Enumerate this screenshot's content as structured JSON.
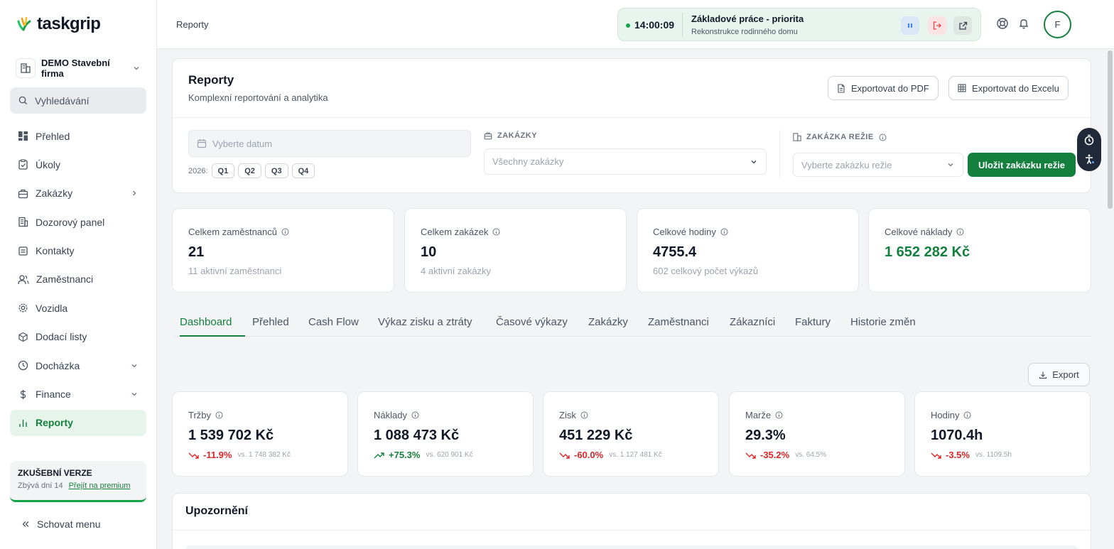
{
  "app": {
    "brand": "taskgrip"
  },
  "sidebar": {
    "company": "DEMO Stavební firma",
    "search_label": "Vyhledávání",
    "items": [
      {
        "label": "Přehled",
        "icon": "dashboard-icon"
      },
      {
        "label": "Úkoly",
        "icon": "clipboard-check-icon"
      },
      {
        "label": "Zakázky",
        "icon": "briefcase-icon"
      },
      {
        "label": "Dozorový panel",
        "icon": "building-panel-icon"
      },
      {
        "label": "Kontakty",
        "icon": "contacts-icon"
      },
      {
        "label": "Zaměstnanci",
        "icon": "users-icon"
      },
      {
        "label": "Vozidla",
        "icon": "gear-icon"
      },
      {
        "label": "Dodací listy",
        "icon": "package-icon"
      },
      {
        "label": "Docházka",
        "icon": "clock-icon"
      },
      {
        "label": "Finance",
        "icon": "dollar-icon"
      },
      {
        "label": "Reporty",
        "icon": "bar-chart-icon",
        "active": true
      }
    ],
    "trial": {
      "title": "ZKUŠEBNÍ VERZE",
      "days_left": "Zbývá dní 14",
      "upgrade_link": "Přejít na premium"
    },
    "hide_menu": "Schovat menu"
  },
  "topbar": {
    "title": "Reporty",
    "timer": {
      "time": "14:00:09",
      "task": "Základové práce - priorita",
      "project": "Rekonstrukce rodinného domu"
    },
    "avatar_initial": "F"
  },
  "reports": {
    "title": "Reporty",
    "subtitle": "Komplexní reportování a analytika",
    "export_pdf": "Exportovat do PDF",
    "export_excel": "Exportovat do Excelu",
    "date_placeholder": "Vyberte datum",
    "year_label": "2026:",
    "quarters": [
      "Q1",
      "Q2",
      "Q3",
      "Q4"
    ],
    "jobs_label": "ZAKÁZKY",
    "jobs_value": "Všechny zakázky",
    "overhead_label": "ZAKÁZKA REŽIE",
    "overhead_placeholder": "Vyberte zakázku režie",
    "save_overhead": "Uložit zakázku režie"
  },
  "summary": [
    {
      "label": "Celkem zaměstnanců",
      "value": "21",
      "sub": "11 aktivní zaměstnanci"
    },
    {
      "label": "Celkem zakázek",
      "value": "10",
      "sub": "4 aktivní zakázky"
    },
    {
      "label": "Celkové hodiny",
      "value": "4755.4",
      "sub": "602 celkový počet výkazů"
    },
    {
      "label": "Celkové náklady",
      "value": "1 652 282 Kč",
      "sub": ""
    }
  ],
  "tabs": [
    "Dashboard",
    "Přehled",
    "Cash Flow",
    "Výkaz zisku a ztráty",
    "Časové výkazy",
    "Zakázky",
    "Zaměstnanci",
    "Zákazníci",
    "Faktury",
    "Historie změn"
  ],
  "export_label": "Export",
  "kpis": [
    {
      "label": "Tržby",
      "value": "1 539 702 Kč",
      "change": "-11.9%",
      "vs": "vs. 1 748 382 Kč",
      "trend": "down"
    },
    {
      "label": "Náklady",
      "value": "1 088 473 Kč",
      "change": "+75.3%",
      "vs": "vs. 620 901 Kč",
      "trend": "up"
    },
    {
      "label": "Zisk",
      "value": "451 229 Kč",
      "change": "-60.0%",
      "vs": "vs. 1 127 481 Kč",
      "trend": "down"
    },
    {
      "label": "Marže",
      "value": "29.3%",
      "change": "-35.2%",
      "vs": "vs. 64.5%",
      "trend": "down"
    },
    {
      "label": "Hodiny",
      "value": "1070.4h",
      "change": "-3.5%",
      "vs": "vs. 1109.5h",
      "trend": "down"
    }
  ],
  "alerts": {
    "title": "Upozornění"
  },
  "colors": {
    "accent": "#15803d",
    "negative": "#dc2626",
    "positive": "#15803d"
  }
}
